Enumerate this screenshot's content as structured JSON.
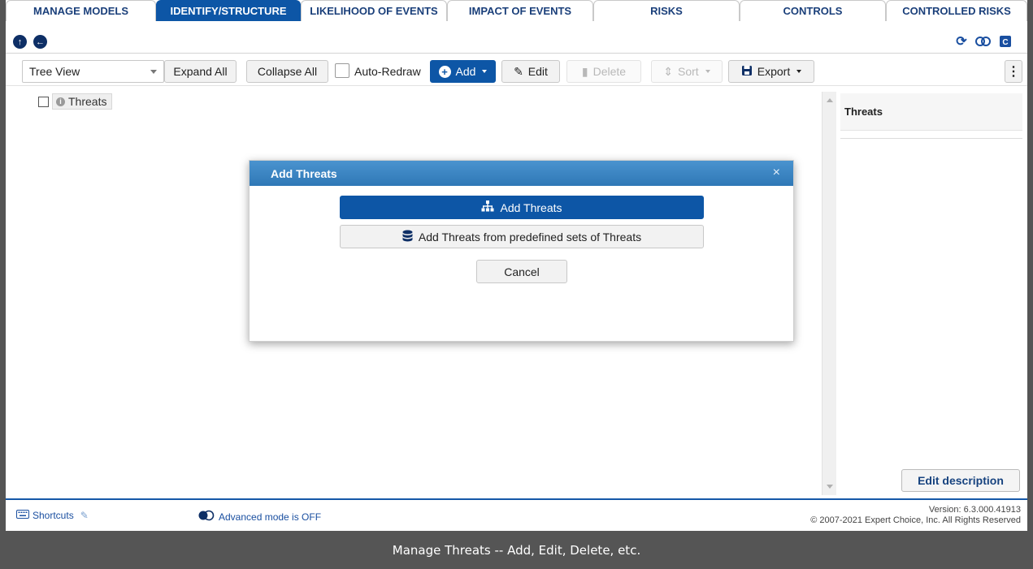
{
  "tabs": [
    {
      "label": "MANAGE MODELS"
    },
    {
      "label": "IDENTIFY/STRUCTURE"
    },
    {
      "label": "LIKELIHOOD OF EVENTS"
    },
    {
      "label": "IMPACT OF EVENTS"
    },
    {
      "label": "RISKS"
    },
    {
      "label": "CONTROLS"
    },
    {
      "label": "CONTROLLED RISKS"
    }
  ],
  "active_tab": "IDENTIFY/STRUCTURE",
  "colors": {
    "accent": "#0d56a6",
    "modal_header": "#3d87c4",
    "caption_bg": "#555555"
  },
  "toolbar": {
    "view_select": "Tree View",
    "expand_all": "Expand All",
    "collapse_all": "Collapse All",
    "auto_redraw": "Auto-Redraw",
    "auto_redraw_checked": false,
    "add": "Add",
    "edit": "Edit",
    "delete": "Delete",
    "sort": "Sort",
    "export": "Export"
  },
  "tree": {
    "root_label": "Threats"
  },
  "right_panel": {
    "title": "Threats",
    "edit_description": "Edit description"
  },
  "modal": {
    "title": "Add Threats",
    "close": "×",
    "option_add": "Add Threats",
    "option_predefined": "Add Threats from predefined sets of Threats",
    "cancel": "Cancel"
  },
  "footer": {
    "shortcuts": "Shortcuts",
    "advanced_mode": "Advanced mode is OFF",
    "version": "Version: 6.3.000.41913",
    "copyright": "© 2007-2021 Expert Choice, Inc. All Rights Reserved"
  },
  "caption": "Manage Threats -- Add, Edit, Delete, etc."
}
